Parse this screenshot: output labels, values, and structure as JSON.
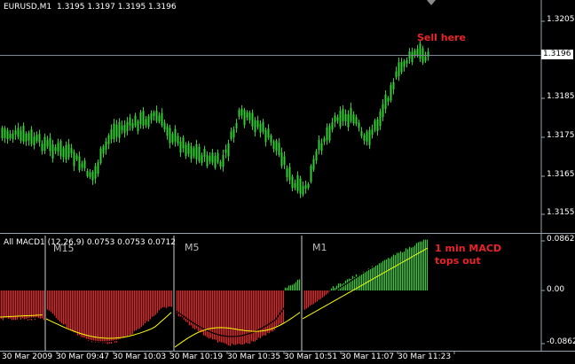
{
  "header": {
    "symbol": "EURUSD,M1",
    "ohlc": "1.3195 1.3197 1.3195 1.3196"
  },
  "price_axis": {
    "ticks": [
      "1.3205",
      "1.3185",
      "1.3175",
      "1.3165",
      "1.3155"
    ],
    "current_price": "1.3196"
  },
  "indicator": {
    "title": "All MACD1 (12,26,9) 0.0753 0.0753 0.0712",
    "ticks": [
      "0.0862",
      "0.00",
      "-0.0862"
    ],
    "sections": [
      "M15",
      "M5",
      "M1"
    ]
  },
  "annotations": {
    "sell": "Sell here",
    "macd_line1": "1 min MACD",
    "macd_line2": "tops out"
  },
  "time_axis": {
    "ticks": [
      "30 Mar 2009",
      "30 Mar 09:47",
      "30 Mar 10:03",
      "30 Mar 10:19",
      "30 Mar 10:35",
      "30 Mar 10:51",
      "30 Mar 11:07",
      "30 Mar 11:23"
    ]
  },
  "colors": {
    "bull": "#33cc33",
    "bear": "#e8242a",
    "signal": "#ffff00",
    "macd_line": "#000000",
    "grid": "#9aa5ad"
  }
}
